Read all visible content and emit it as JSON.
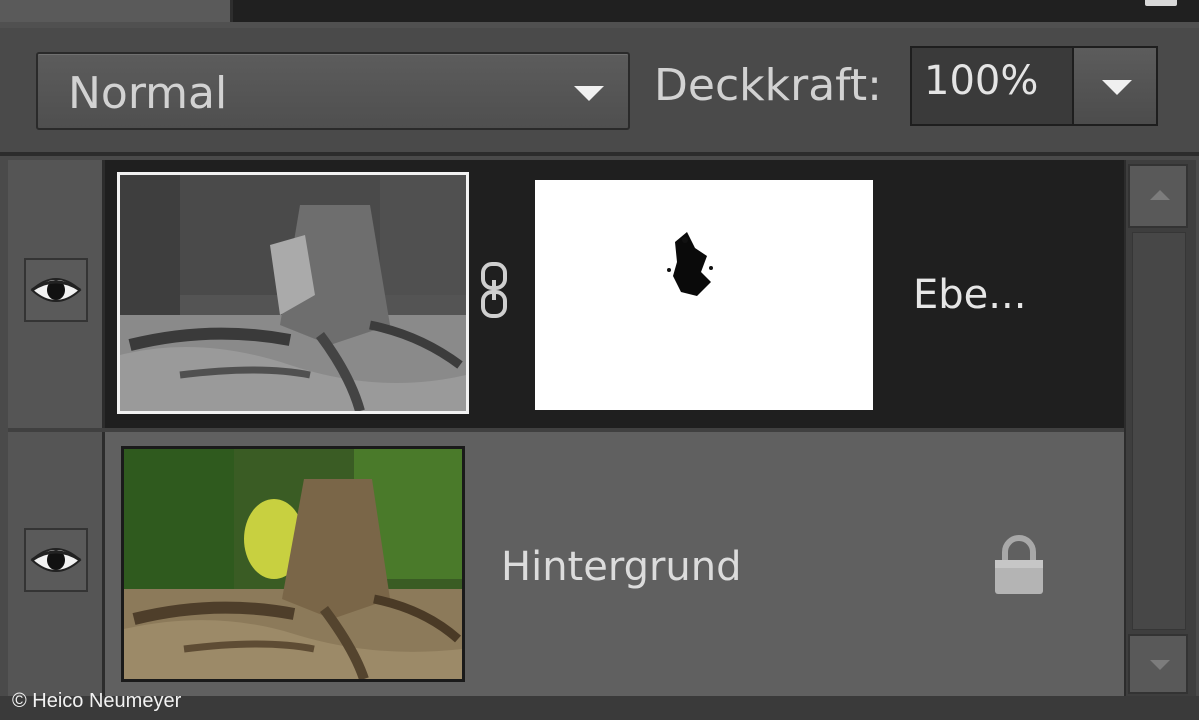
{
  "layer_panel": {
    "blend_mode": "Normal",
    "opacity_label": "Deckkraft:",
    "opacity_value": "100%",
    "layers": [
      {
        "name": "Ebe...",
        "visible": true,
        "selected": true,
        "has_mask": true,
        "linked": true,
        "locked": false,
        "thumbnail": "tree-stump-grayscale"
      },
      {
        "name": "Hintergrund",
        "visible": true,
        "selected": false,
        "has_mask": false,
        "locked": true,
        "thumbnail": "tree-stump-color"
      }
    ]
  },
  "icons": {
    "visibility": "eye-icon",
    "link": "chain-link-icon",
    "lock": "lock-icon",
    "dropdown": "chevron-down-icon",
    "scroll_up": "arrow-up-icon",
    "scroll_down": "arrow-down-icon"
  },
  "colors": {
    "panel_bg": "#4a4a4a",
    "selected_row": "#1f1f1f",
    "normal_row": "#606060",
    "text": "#d2d2d2"
  },
  "copyright": "© Heico Neumeyer"
}
